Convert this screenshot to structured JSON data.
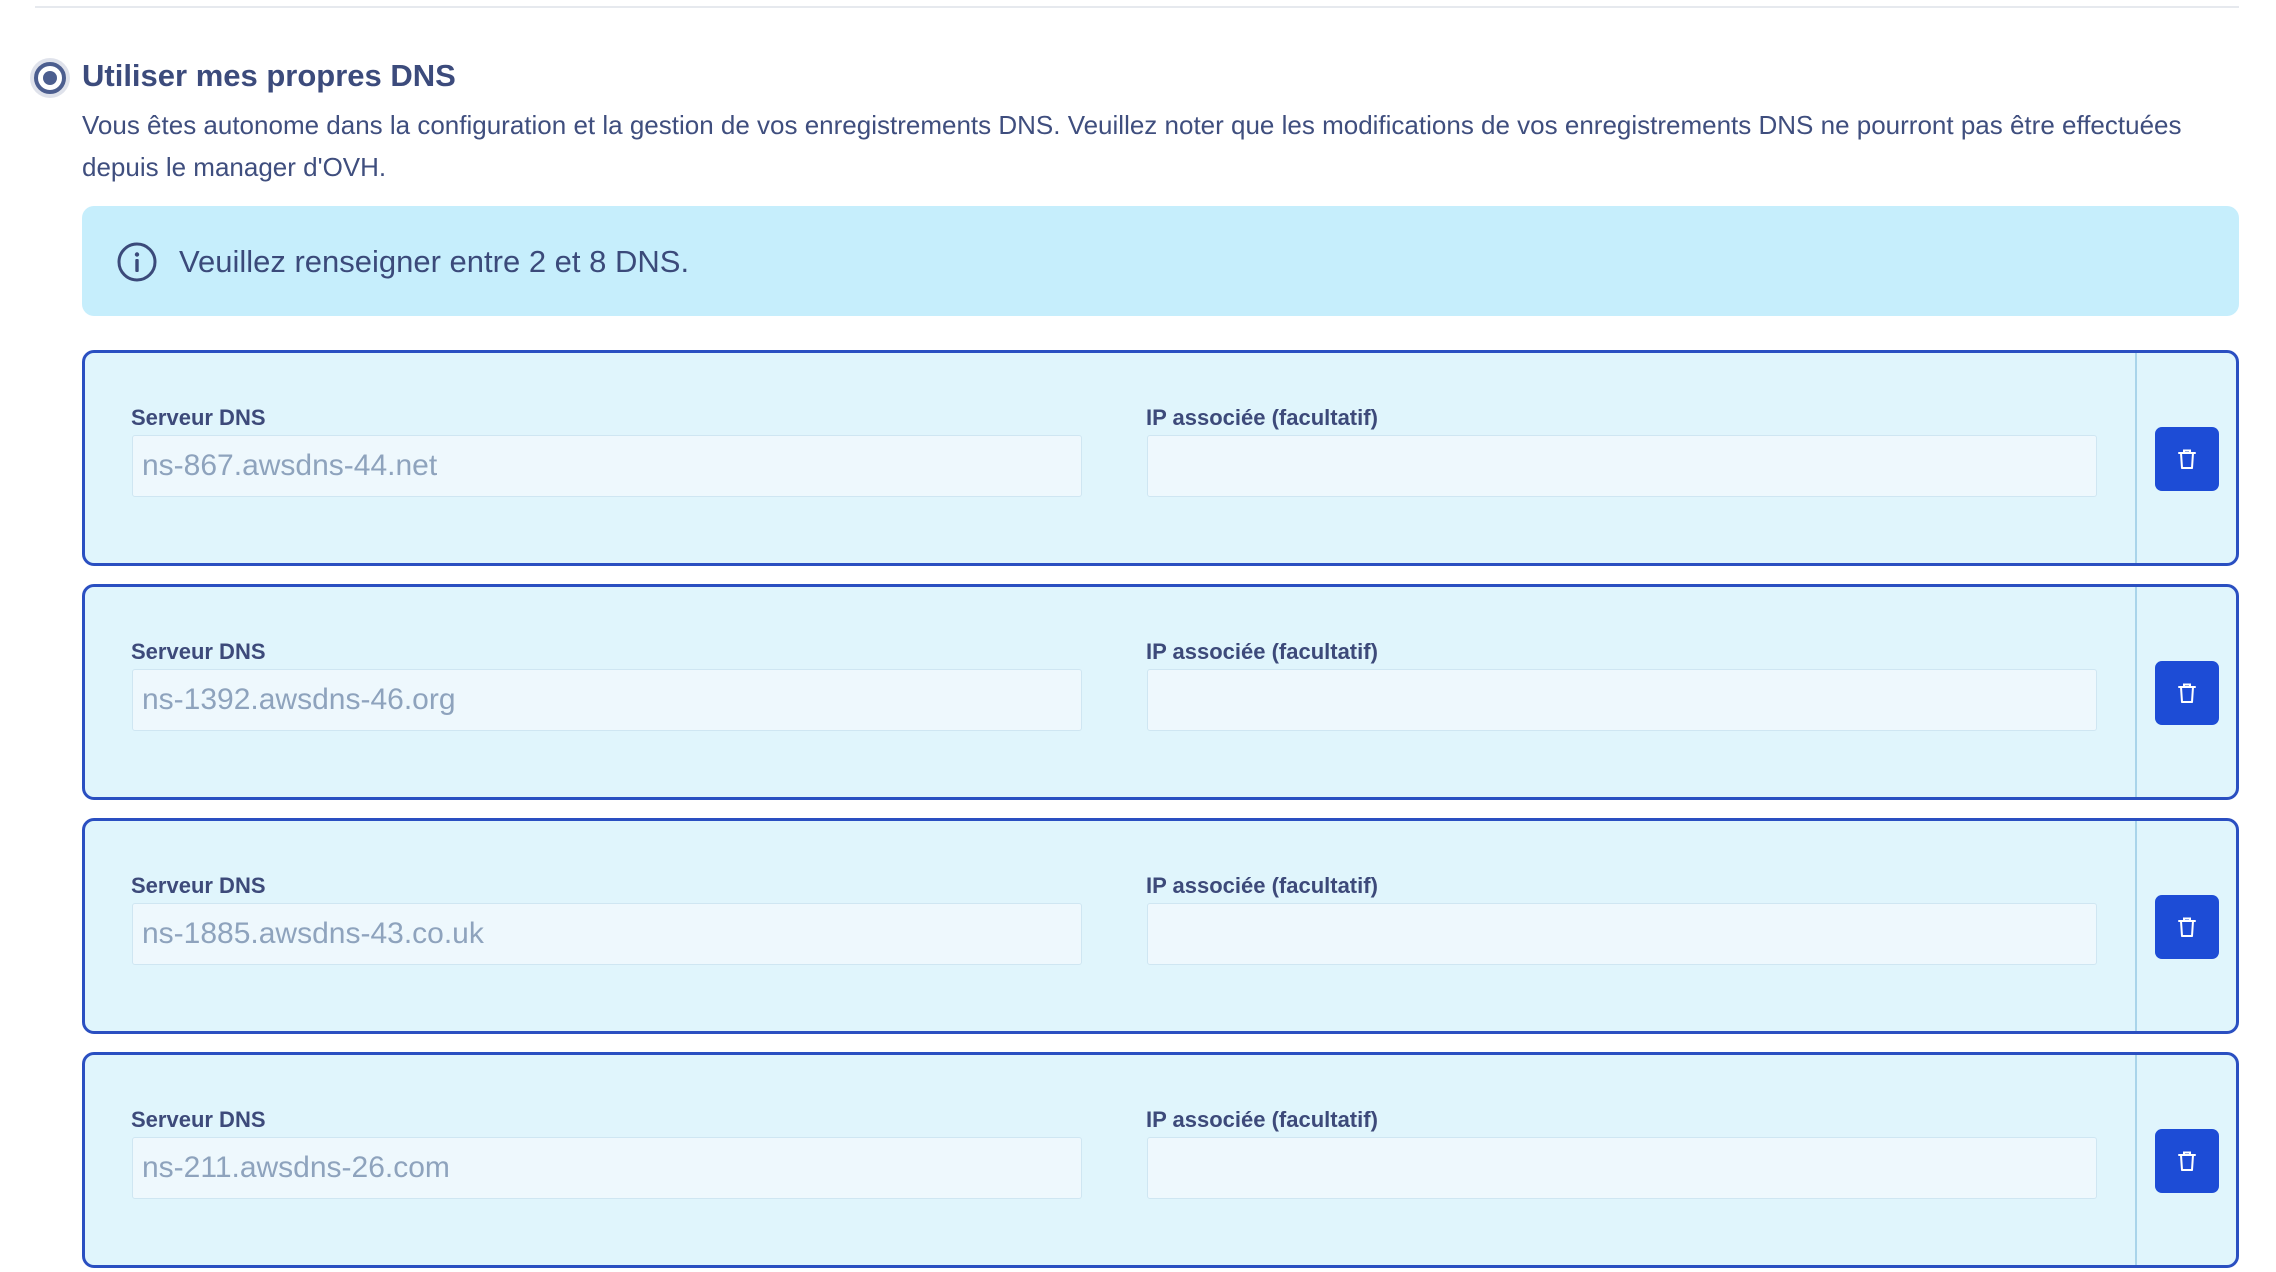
{
  "option": {
    "title": "Utiliser mes propres DNS",
    "description": "Vous êtes autonome dans la configuration et la gestion de vos enregistrements DNS. Veuillez noter que les modifications de vos enregistrements DNS ne pourront pas être effectuées depuis le manager d'OVH.",
    "selected": true,
    "radio_icon": "radio-selected-icon"
  },
  "info": {
    "icon": "info-circle-icon",
    "text": "Veuillez renseigner entre 2 et 8 DNS."
  },
  "dns_rows": [
    {
      "server_label": "Serveur DNS",
      "server_placeholder": "ns-867.awsdns-44.net",
      "ip_label": "IP associée (facultatif)",
      "ip_value": "",
      "delete_icon": "trash-icon"
    },
    {
      "server_label": "Serveur DNS",
      "server_placeholder": "ns-1392.awsdns-46.org",
      "ip_label": "IP associée (facultatif)",
      "ip_value": "",
      "delete_icon": "trash-icon"
    },
    {
      "server_label": "Serveur DNS",
      "server_placeholder": "ns-1885.awsdns-43.co.uk",
      "ip_label": "IP associée (facultatif)",
      "ip_value": "",
      "delete_icon": "trash-icon"
    },
    {
      "server_label": "Serveur DNS",
      "server_placeholder": "ns-211.awsdns-26.com",
      "ip_label": "IP associée (facultatif)",
      "ip_value": "",
      "delete_icon": "trash-icon"
    }
  ],
  "colors": {
    "primary": "#1d4cd6",
    "row_border": "#2a4fc1",
    "row_background": "#e0f5fc",
    "info_background": "#c6eefc",
    "text": "#3c4b7c"
  }
}
